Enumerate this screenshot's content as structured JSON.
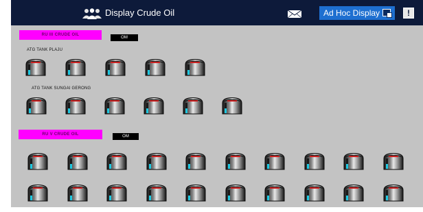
{
  "header": {
    "title": "Display Crude Oil",
    "adhoc_label": "Ad Hoc Display",
    "alert_symbol": "!",
    "icons": [
      "users-icon",
      "mail-icon",
      "display-window-icon",
      "alert-icon"
    ],
    "colors": {
      "bar": "#0d1a3a",
      "button": "#1e6fd0"
    }
  },
  "sections": [
    {
      "label": "RU III CRUDE OIL",
      "status": "OM",
      "groups": [
        {
          "label": "ATG TANK PLAJU",
          "tanks": [
            {
              "level": 0.45
            },
            {
              "level": 0.45
            },
            {
              "level": 0.45
            },
            {
              "level": 0.45
            },
            {
              "level": 0.45
            }
          ]
        },
        {
          "label": "ATG TANK SUNGAI GERONG",
          "tanks": [
            {
              "level": 0.45
            },
            {
              "level": 0.45
            },
            {
              "level": 0.45
            },
            {
              "level": 0.45
            },
            {
              "level": 0.45
            },
            {
              "level": 0.45
            }
          ]
        }
      ]
    },
    {
      "label": "RU V CRUDE OIL",
      "status": "OM",
      "groups": [
        {
          "label": "",
          "tanks": [
            {
              "level": 0.45
            },
            {
              "level": 0.45
            },
            {
              "level": 0.45
            },
            {
              "level": 0.45
            },
            {
              "level": 0.45
            },
            {
              "level": 0.45
            },
            {
              "level": 0.45
            },
            {
              "level": 0.45
            },
            {
              "level": 0.45
            },
            {
              "level": 0.45
            }
          ]
        },
        {
          "label": "",
          "tanks": [
            {
              "level": 0.45
            },
            {
              "level": 0.45
            },
            {
              "level": 0.45
            },
            {
              "level": 0.45
            },
            {
              "level": 0.45
            },
            {
              "level": 0.45
            },
            {
              "level": 0.45
            },
            {
              "level": 0.45
            },
            {
              "level": 0.45
            },
            {
              "level": 0.45
            }
          ]
        }
      ]
    }
  ],
  "colors": {
    "panel": "#c3c3c3",
    "unit_label": "#ff00ff",
    "tank_level": "#1ec8e0",
    "tank_readout": "#cc2222"
  }
}
